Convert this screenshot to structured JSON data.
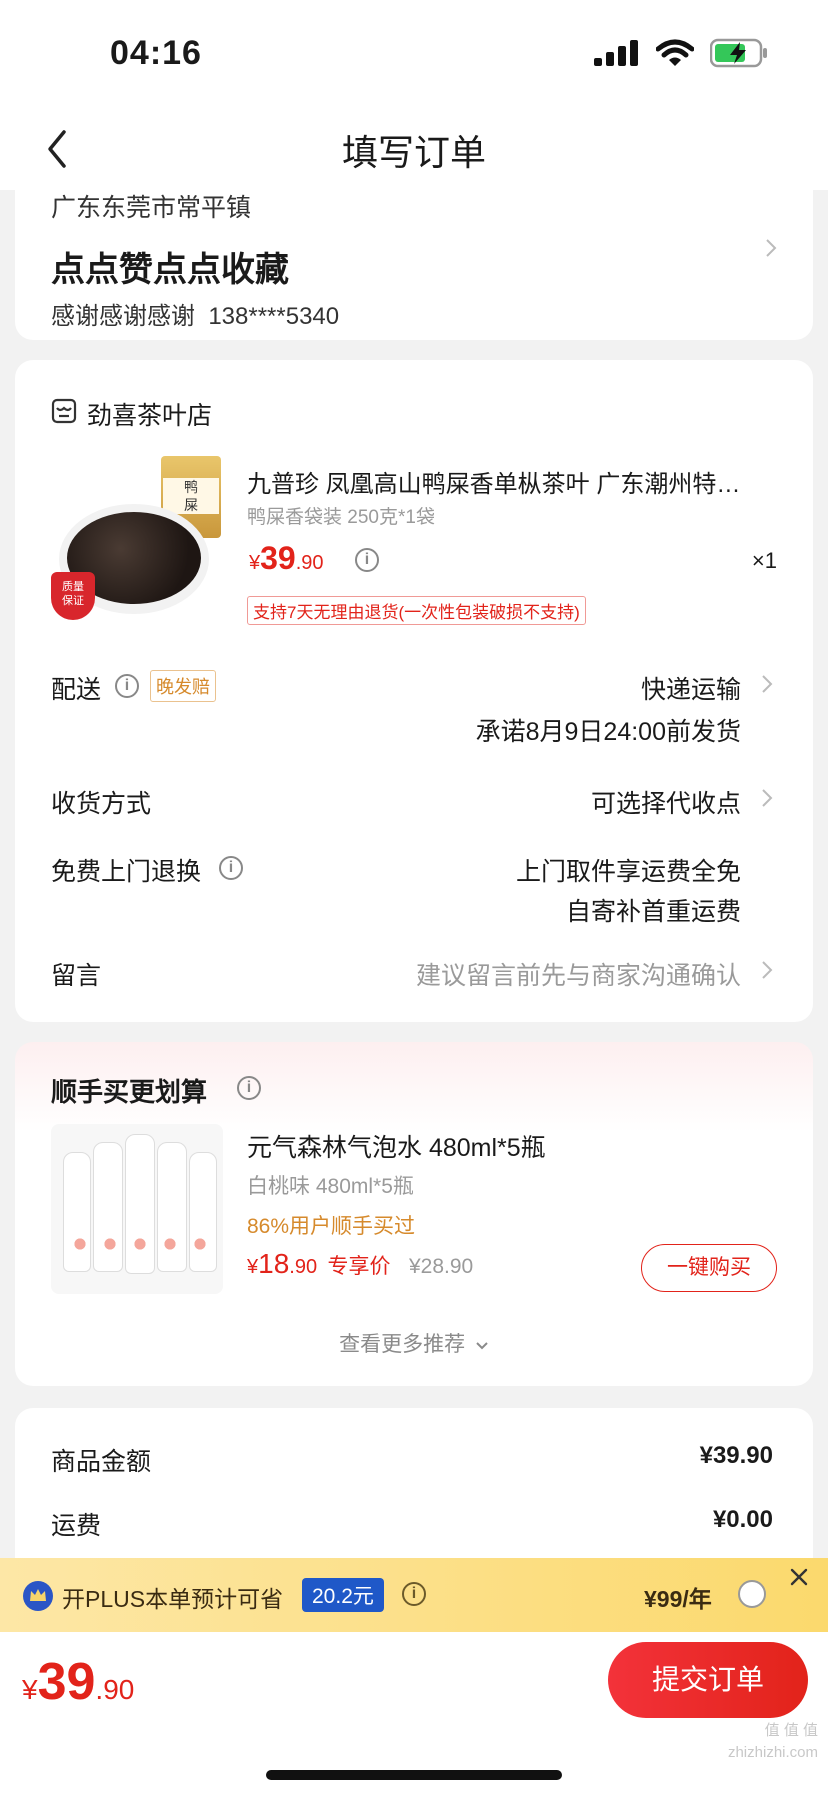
{
  "status_bar": {
    "time": "04:16"
  },
  "nav": {
    "title": "填写订单"
  },
  "address": {
    "region": "广东东莞市常平镇",
    "detail": "点点赞点点收藏",
    "contact": "感谢感谢感谢  138****5340"
  },
  "store": {
    "name": "劲喜茶叶店",
    "product": {
      "title": "九普珍 凤凰高山鸭屎香单枞茶叶 广东潮州特…",
      "spec": "鸭屎香袋装 250克*1袋",
      "price_symbol": "¥",
      "price_int": "39",
      "price_dec": ".90",
      "qty": "×1",
      "return_tag": "支持7天无理由退货(一次性包装破损不支持)",
      "badge_line1": "质量",
      "badge_line2": "保证"
    },
    "delivery": {
      "label": "配送",
      "tag": "晚发赔",
      "method": "快递运输",
      "promise": "承诺8月9日24:00前发货"
    },
    "receive": {
      "label": "收货方式",
      "value": "可选择代收点"
    },
    "free_return": {
      "label": "免费上门退换",
      "value1": "上门取件享运费全免",
      "value2": "自寄补首重运费"
    },
    "message": {
      "label": "留言",
      "placeholder": "建议留言前先与商家沟通确认"
    }
  },
  "recommend": {
    "title": "顺手买更划算",
    "item": {
      "title": "元气森林气泡水 480ml*5瓶",
      "spec": "白桃味 480ml*5瓶",
      "note": "86%用户顺手买过",
      "price_symbol": "¥",
      "price_int": "18",
      "price_dec": ".90",
      "price_tag": "专享价",
      "orig_price": "¥28.90",
      "buy_label": "一键购买"
    },
    "more": "查看更多推荐"
  },
  "summary": {
    "goods_label": "商品金额",
    "goods_value": "¥39.90",
    "shipping_label": "运费",
    "shipping_value": "¥0.00"
  },
  "plus": {
    "text": "开PLUS本单预计可省",
    "saving": "20.2元",
    "price": "¥99/年"
  },
  "footer": {
    "total_symbol": "¥",
    "total_int": "39",
    "total_dec": ".90",
    "submit": "提交订单"
  },
  "watermark": "值 值 值 zhizhizhi.com",
  "colors": {
    "accent": "#e2231a",
    "plus": "#fbd96d",
    "orange": "#d68a2c"
  }
}
